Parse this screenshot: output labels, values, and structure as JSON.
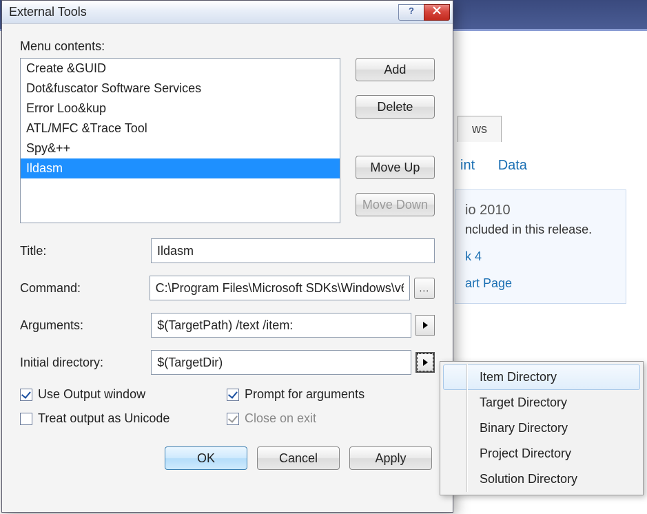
{
  "bg": {
    "tab": "ws",
    "links": [
      "int",
      "Data"
    ],
    "panel_title": "io 2010",
    "panel_text": "ncluded in this release.",
    "link1": "k 4",
    "link2": "art Page"
  },
  "dialog": {
    "title": "External Tools",
    "menu_contents_label": "Menu contents:",
    "items": [
      "Create &GUID",
      "Dot&fuscator Software Services",
      "Error Loo&kup",
      "ATL/MFC &Trace Tool",
      "Spy&++",
      "Ildasm"
    ],
    "selected_index": 5,
    "buttons": {
      "add": "Add",
      "delete": "Delete",
      "move_up": "Move Up",
      "move_down": "Move Down"
    },
    "fields": {
      "title_label": "Title:",
      "title_value": "Ildasm",
      "command_label": "Command:",
      "command_value": "C:\\Program Files\\Microsoft SDKs\\Windows\\v6",
      "arguments_label": "Arguments:",
      "arguments_value": "$(TargetPath) /text /item:",
      "initdir_label": "Initial directory:",
      "initdir_value": "$(TargetDir)",
      "browse": "..."
    },
    "checks": {
      "use_output": "Use Output window",
      "prompt_args": "Prompt for arguments",
      "treat_unicode": "Treat output as Unicode",
      "close_exit": "Close on exit"
    },
    "footer": {
      "ok": "OK",
      "cancel": "Cancel",
      "apply": "Apply"
    }
  },
  "popup": {
    "items": [
      "Item Directory",
      "Target Directory",
      "Binary Directory",
      "Project Directory",
      "Solution Directory"
    ],
    "hover_index": 0
  }
}
